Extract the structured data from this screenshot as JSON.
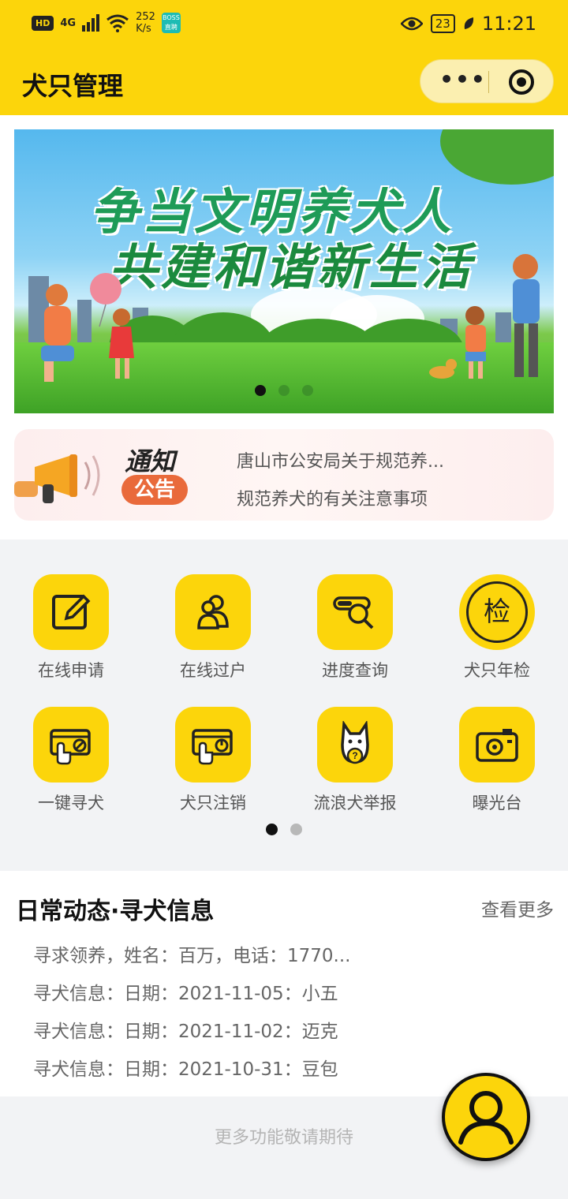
{
  "status_bar": {
    "hd": "HD",
    "network": "4G",
    "speed_value": "252",
    "speed_unit": "K/s",
    "app_badge_top": "BOSS",
    "app_badge_bottom": "直聘",
    "battery": "23",
    "time": "11:21"
  },
  "titlebar": {
    "title": "犬只管理",
    "more": "•••"
  },
  "banner": {
    "slogan_line1": "争当文明养犬人",
    "slogan_line2": "共建和谐新生活",
    "active_index": 0,
    "dot_count": 3
  },
  "notice": {
    "tag_top": "通知",
    "tag_bottom": "公告",
    "items": [
      "唐山市公安局关于规范养...",
      "规范养犬的有关注意事项"
    ]
  },
  "services": [
    {
      "label": "在线申请",
      "icon": "edit-icon"
    },
    {
      "label": "在线过户",
      "icon": "transfer-users-icon"
    },
    {
      "label": "进度查询",
      "icon": "progress-search-icon"
    },
    {
      "label": "犬只年检",
      "icon": "inspection-icon",
      "glyph": "检"
    },
    {
      "label": "一键寻犬",
      "icon": "find-dog-card-icon"
    },
    {
      "label": "犬只注销",
      "icon": "cancel-card-icon"
    },
    {
      "label": "流浪犬举报",
      "icon": "stray-dog-report-icon"
    },
    {
      "label": "曝光台",
      "icon": "camera-icon"
    }
  ],
  "services_pager": {
    "active_index": 0,
    "count": 2
  },
  "news": {
    "title": "日常动态·寻犬信息",
    "more": "查看更多",
    "items": [
      "寻求领养，姓名：百万，电话：1770...",
      "寻犬信息：日期：2021-11-05：小五",
      "寻犬信息：日期：2021-11-02：迈克",
      "寻犬信息：日期：2021-10-31：豆包"
    ]
  },
  "footer": {
    "text": "更多功能敬请期待"
  },
  "colors": {
    "brand": "#fcd50b",
    "notice_tag": "#e96a3b"
  }
}
